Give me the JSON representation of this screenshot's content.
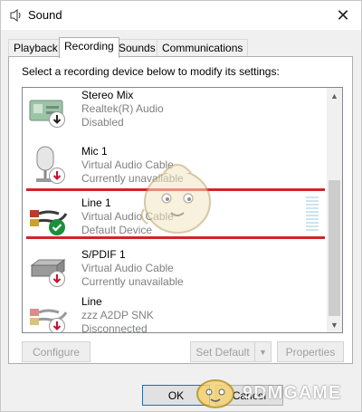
{
  "window": {
    "title": "Sound",
    "close_glyph": "✕"
  },
  "tabs": [
    {
      "label": "Playback",
      "active": false
    },
    {
      "label": "Recording",
      "active": true
    },
    {
      "label": "Sounds",
      "active": false
    },
    {
      "label": "Communications",
      "active": false
    }
  ],
  "instruction": "Select a recording device below to modify its settings:",
  "devices": [
    {
      "name": "Stereo Mix",
      "driver": "Realtek(R) Audio",
      "status": "Disabled",
      "icon": "stereo-mix-icon",
      "badge": "arrow-down-badge"
    },
    {
      "name": "Mic 1",
      "driver": "Virtual Audio Cable",
      "status": "Currently unavailable",
      "icon": "microphone-icon",
      "badge": "arrow-down-badge"
    },
    {
      "name": "Line 1",
      "driver": "Virtual Audio Cable",
      "status": "Default Device",
      "icon": "line-in-cable-icon",
      "badge": "checkmark-badge",
      "selected": true
    },
    {
      "name": "S/PDIF 1",
      "driver": "Virtual Audio Cable",
      "status": "Currently unavailable",
      "icon": "spdif-box-icon",
      "badge": "arrow-down-badge"
    },
    {
      "name": "Line",
      "driver": "zzz A2DP SNK",
      "status": "Disconnected",
      "icon": "line-in-cable-icon",
      "badge": "arrow-down-badge"
    }
  ],
  "buttons": {
    "configure": "Configure",
    "set_default": "Set Default",
    "properties": "Properties",
    "ok": "OK",
    "cancel": "Cancel"
  },
  "watermark": {
    "text": "9DMGAME"
  },
  "colors": {
    "highlight_line": "#d32424",
    "level_meter": "#cbe5ee",
    "badge_check": "#1a8f3c",
    "badge_down": "#c8102e"
  }
}
